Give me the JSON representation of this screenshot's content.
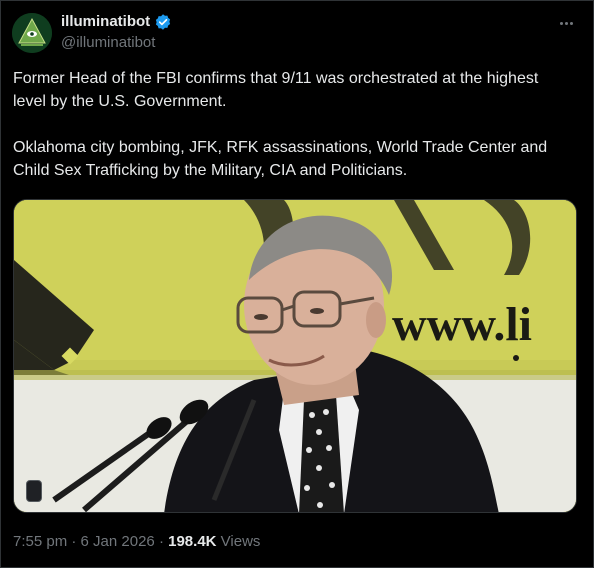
{
  "user": {
    "display_name": "illuminatibot",
    "handle": "@illuminatibot",
    "verified": true,
    "verified_color": "#1d9bf0",
    "avatar_icon": "pyramid-eye-avatar"
  },
  "tweet": {
    "paragraph_1": "Former Head of the FBI confirms that 9/11 was orchestrated at the highest level by the U.S. Government.",
    "paragraph_2": "Oklahoma city bombing, JFK, RFK assassinations, World Trade Center and Child Sex Trafficking by the Military, CIA and Politicians."
  },
  "media": {
    "type": "video",
    "banner_text": "www.li"
  },
  "meta": {
    "time": "7:55 pm",
    "separator": "·",
    "date": "6 Jan 2026",
    "views_count": "198.4K",
    "views_label": "Views"
  },
  "colors": {
    "background": "#000000",
    "text_primary": "#e7e9ea",
    "text_secondary": "#71767b",
    "border": "#2f3336"
  }
}
